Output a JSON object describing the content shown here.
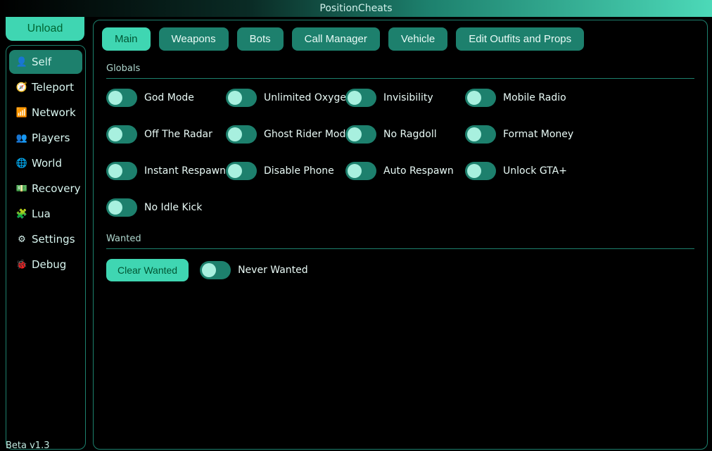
{
  "title": "PositionCheats",
  "unload_label": "Unload",
  "version": "Beta v1.3",
  "sidebar": {
    "items": [
      {
        "key": "self",
        "label": "Self",
        "icon": "user-icon",
        "active": true
      },
      {
        "key": "teleport",
        "label": "Teleport",
        "icon": "compass-icon",
        "active": false
      },
      {
        "key": "network",
        "label": "Network",
        "icon": "wifi-icon",
        "active": false
      },
      {
        "key": "players",
        "label": "Players",
        "icon": "people-icon",
        "active": false
      },
      {
        "key": "world",
        "label": "World",
        "icon": "globe-icon",
        "active": false
      },
      {
        "key": "recovery",
        "label": "Recovery",
        "icon": "cash-icon",
        "active": false
      },
      {
        "key": "lua",
        "label": "Lua",
        "icon": "puzzle-icon",
        "active": false
      },
      {
        "key": "settings",
        "label": "Settings",
        "icon": "gear-icon",
        "active": false
      },
      {
        "key": "debug",
        "label": "Debug",
        "icon": "bug-icon",
        "active": false
      }
    ]
  },
  "tabs": [
    {
      "key": "main",
      "label": "Main",
      "active": true
    },
    {
      "key": "weapons",
      "label": "Weapons",
      "active": false
    },
    {
      "key": "bots",
      "label": "Bots",
      "active": false
    },
    {
      "key": "callmgr",
      "label": "Call Manager",
      "active": false
    },
    {
      "key": "vehicle",
      "label": "Vehicle",
      "active": false
    },
    {
      "key": "outfits",
      "label": "Edit Outfits and Props",
      "active": false
    }
  ],
  "sections": {
    "globals": {
      "label": "Globals",
      "toggles": [
        {
          "key": "god_mode",
          "label": "God Mode"
        },
        {
          "key": "unlimited_oxygen",
          "label": "Unlimited Oxygen"
        },
        {
          "key": "invisibility",
          "label": "Invisibility"
        },
        {
          "key": "mobile_radio",
          "label": "Mobile Radio"
        },
        {
          "key": "off_the_radar",
          "label": "Off The Radar"
        },
        {
          "key": "ghost_rider",
          "label": "Ghost Rider Mode"
        },
        {
          "key": "no_ragdoll",
          "label": "No Ragdoll"
        },
        {
          "key": "format_money",
          "label": "Format Money"
        },
        {
          "key": "instant_respawn",
          "label": "Instant Respawn"
        },
        {
          "key": "disable_phone",
          "label": "Disable Phone"
        },
        {
          "key": "auto_respawn",
          "label": "Auto Respawn"
        },
        {
          "key": "unlock_gta_plus",
          "label": "Unlock GTA+"
        },
        {
          "key": "no_idle_kick",
          "label": "No Idle Kick"
        }
      ]
    },
    "wanted": {
      "label": "Wanted",
      "clear_label": "Clear Wanted",
      "never_label": "Never Wanted"
    }
  },
  "icon_glyphs": {
    "user-icon": "👤",
    "compass-icon": "🧭",
    "wifi-icon": "📶",
    "people-icon": "👥",
    "globe-icon": "🌐",
    "cash-icon": "💵",
    "puzzle-icon": "🧩",
    "gear-icon": "⚙",
    "bug-icon": "🐞"
  }
}
